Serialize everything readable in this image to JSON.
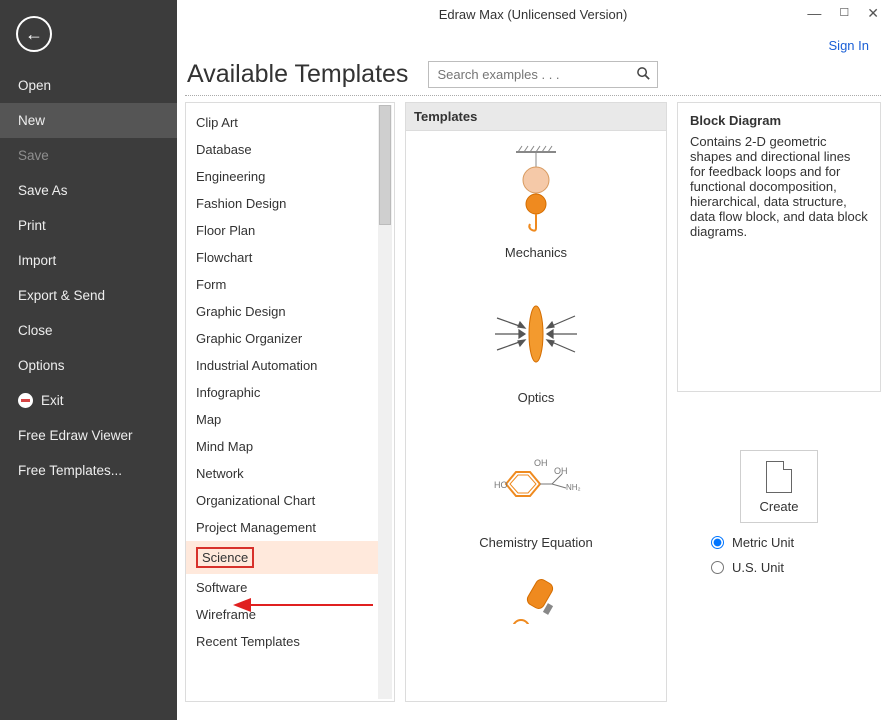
{
  "window": {
    "title": "Edraw Max (Unlicensed Version)"
  },
  "signin_label": "Sign In",
  "sidebar": {
    "items": [
      {
        "label": "Open",
        "state": ""
      },
      {
        "label": "New",
        "state": "active"
      },
      {
        "label": "Save",
        "state": "disabled"
      },
      {
        "label": "Save As",
        "state": ""
      },
      {
        "label": "Print",
        "state": ""
      },
      {
        "label": "Import",
        "state": ""
      },
      {
        "label": "Export & Send",
        "state": ""
      },
      {
        "label": "Close",
        "state": ""
      },
      {
        "label": "Options",
        "state": ""
      },
      {
        "label": "Exit",
        "state": "exit"
      },
      {
        "label": "Free Edraw Viewer",
        "state": ""
      },
      {
        "label": "Free Templates...",
        "state": ""
      }
    ]
  },
  "heading": "Available Templates",
  "search": {
    "placeholder": "Search examples . . ."
  },
  "categories": [
    "Clip Art",
    "Database",
    "Engineering",
    "Fashion Design",
    "Floor Plan",
    "Flowchart",
    "Form",
    "Graphic Design",
    "Graphic Organizer",
    "Industrial Automation",
    "Infographic",
    "Map",
    "Mind Map",
    "Network",
    "Organizational Chart",
    "Project Management",
    "Science",
    "Software",
    "Wireframe",
    "Recent Templates"
  ],
  "highlight_category": "Science",
  "templates_header": "Templates",
  "templates": [
    {
      "label": "Mechanics"
    },
    {
      "label": "Optics"
    },
    {
      "label": "Chemistry Equation"
    }
  ],
  "description": {
    "title": "Block Diagram",
    "body": "Contains 2-D geometric shapes and directional lines for feedback loops and for functional docomposition, hierarchical, data structure, data flow block, and data block diagrams."
  },
  "create_label": "Create",
  "units": {
    "metric": "Metric Unit",
    "us": "U.S. Unit",
    "selected": "metric"
  }
}
